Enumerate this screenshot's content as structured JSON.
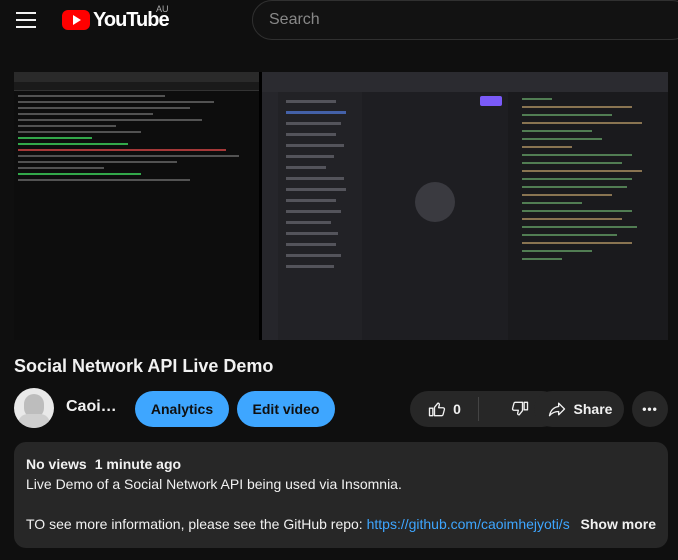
{
  "header": {
    "logo_text": "YouTube",
    "region": "AU",
    "search_placeholder": "Search"
  },
  "video": {
    "title": "Social Network API Live Demo"
  },
  "owner": {
    "name": "Caoi…",
    "analytics_label": "Analytics",
    "edit_label": "Edit video"
  },
  "actions": {
    "like_count": "0",
    "share_label": "Share",
    "more_label": "•••"
  },
  "description": {
    "views": "No views",
    "time": "1 minute ago",
    "line1": "Live Demo of a Social Network API being used via Insomnia.",
    "repo_prefix": "TO see more information, please see the GitHub repo: ",
    "repo_link": "https://github.com/caoimhejyoti/s",
    "show_more": "Show more"
  },
  "colors": {
    "background": "#0f0f0f",
    "accent_blue": "#3ea6ff",
    "pill_gray": "#272727",
    "brand_red": "#ff0000"
  },
  "icons": [
    "menu-icon",
    "youtube-logo",
    "like-icon",
    "dislike-icon",
    "share-icon",
    "more-icon"
  ]
}
